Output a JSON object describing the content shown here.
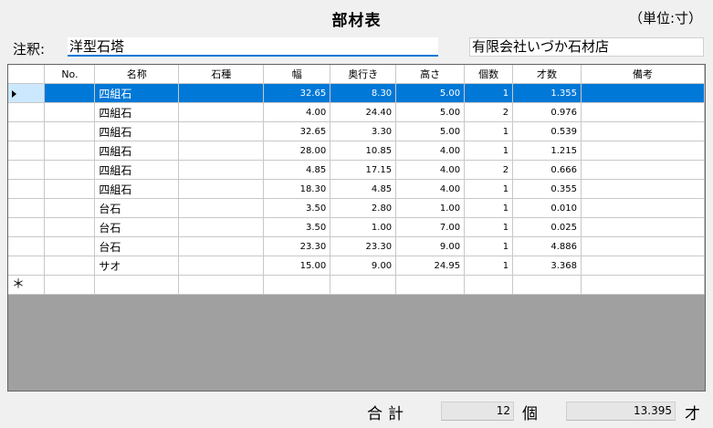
{
  "title": "部材表",
  "unit": "（単位:寸）",
  "note": {
    "label": "注釈:",
    "value": "洋型石塔"
  },
  "company": "有限会社いづか石材店",
  "table": {
    "columns": [
      "No.",
      "名称",
      "石種",
      "幅",
      "奥行き",
      "高さ",
      "個数",
      "才数",
      "備考"
    ],
    "rows": [
      {
        "no": "",
        "name": "四組石",
        "stone": "",
        "width": "32.65",
        "depth": "8.30",
        "height": "5.00",
        "count": "1",
        "sai": "1.355",
        "note": ""
      },
      {
        "no": "",
        "name": "四組石",
        "stone": "",
        "width": "4.00",
        "depth": "24.40",
        "height": "5.00",
        "count": "2",
        "sai": "0.976",
        "note": ""
      },
      {
        "no": "",
        "name": "四組石",
        "stone": "",
        "width": "32.65",
        "depth": "3.30",
        "height": "5.00",
        "count": "1",
        "sai": "0.539",
        "note": ""
      },
      {
        "no": "",
        "name": "四組石",
        "stone": "",
        "width": "28.00",
        "depth": "10.85",
        "height": "4.00",
        "count": "1",
        "sai": "1.215",
        "note": ""
      },
      {
        "no": "",
        "name": "四組石",
        "stone": "",
        "width": "4.85",
        "depth": "17.15",
        "height": "4.00",
        "count": "2",
        "sai": "0.666",
        "note": ""
      },
      {
        "no": "",
        "name": "四組石",
        "stone": "",
        "width": "18.30",
        "depth": "4.85",
        "height": "4.00",
        "count": "1",
        "sai": "0.355",
        "note": ""
      },
      {
        "no": "",
        "name": "台石",
        "stone": "",
        "width": "3.50",
        "depth": "2.80",
        "height": "1.00",
        "count": "1",
        "sai": "0.010",
        "note": ""
      },
      {
        "no": "",
        "name": "台石",
        "stone": "",
        "width": "3.50",
        "depth": "1.00",
        "height": "7.00",
        "count": "1",
        "sai": "0.025",
        "note": ""
      },
      {
        "no": "",
        "name": "台石",
        "stone": "",
        "width": "23.30",
        "depth": "23.30",
        "height": "9.00",
        "count": "1",
        "sai": "4.886",
        "note": ""
      },
      {
        "no": "",
        "name": "サオ",
        "stone": "",
        "width": "15.00",
        "depth": "9.00",
        "height": "24.95",
        "count": "1",
        "sai": "3.368",
        "note": ""
      }
    ],
    "new_row_marker": "＊"
  },
  "totals": {
    "label": "合計",
    "count": "12",
    "count_unit": "個",
    "sai": "13.395",
    "sai_unit": "才"
  },
  "colors": {
    "selection": "#0078d7",
    "selection_header": "#cce8ff",
    "grid_empty": "#a0a0a0"
  }
}
